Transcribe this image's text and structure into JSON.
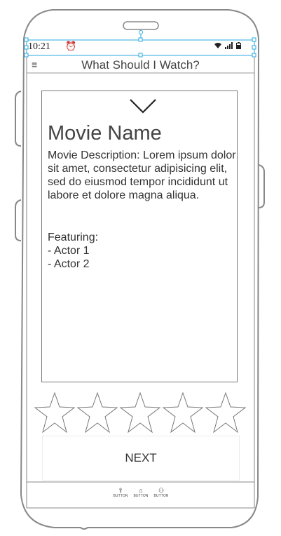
{
  "status_bar": {
    "time": "10:21"
  },
  "header": {
    "title": "What Should I Watch?",
    "menu_glyph": "≡"
  },
  "movie": {
    "name": "Movie Name",
    "description": "Movie Description: Lorem ipsum dolor sit amet, consectetur adipisicing elit, sed do eiusmod tempor incididunt ut labore et dolore magna aliqua.",
    "featuring_label": "Featuring:",
    "actors": [
      "- Actor 1",
      "- Actor 2"
    ]
  },
  "rating": {
    "max_stars": 5,
    "selected": 0
  },
  "actions": {
    "next_label": "NEXT"
  },
  "bottom_nav": [
    {
      "label": "BUTTON",
      "icon": "upload-icon"
    },
    {
      "label": "BUTTON",
      "icon": "bank-icon"
    },
    {
      "label": "BUTTON",
      "icon": "people-icon"
    }
  ],
  "colors": {
    "outline": "#888888",
    "selection": "#29a9e0",
    "text": "#333333"
  }
}
